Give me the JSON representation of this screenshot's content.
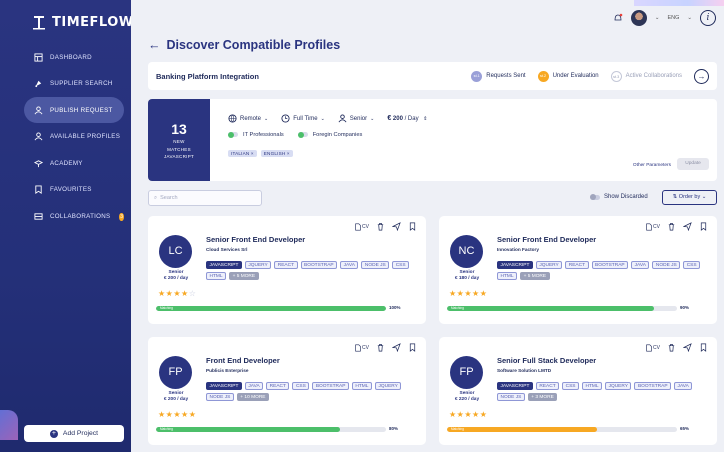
{
  "app": {
    "name": "TIMEFLOW",
    "add_project": "Add Project"
  },
  "sidebar": {
    "items": [
      {
        "label": "DASHBOARD",
        "icon": "dashboard-icon"
      },
      {
        "label": "SUPPLIER SEARCH",
        "icon": "rocket-icon"
      },
      {
        "label": "PUBLISH REQUEST",
        "icon": "people-icon",
        "active": true
      },
      {
        "label": "AVAILABLE PROFILES",
        "icon": "people-icon"
      },
      {
        "label": "ACADEMY",
        "icon": "academy-icon"
      },
      {
        "label": "FAVOURITES",
        "icon": "bookmark-icon"
      },
      {
        "label": "COLLABORATIONS",
        "icon": "collab-icon",
        "badge": "3"
      }
    ]
  },
  "topbar": {
    "lang": "ENG",
    "info": "i"
  },
  "page": {
    "title": "Discover Compatible Profiles"
  },
  "project": {
    "name": "Banking Platform Integration",
    "steps": [
      {
        "label": "Requests Sent",
        "marker": "st.1",
        "color": "#9aa0d8"
      },
      {
        "label": "Under Evaluation",
        "marker": "st.2",
        "color": "#f7a823"
      },
      {
        "label": "Active Collaborations",
        "marker": "st.3",
        "color": "#ffffff"
      }
    ]
  },
  "filter": {
    "count": "13",
    "count_label_1": "NEW",
    "count_label_2": "MATCHES",
    "count_label_3": "JAVASCRIPT",
    "work_mode": "Remote",
    "time": "Full Time",
    "seniority": "Senior",
    "rate_value": "200",
    "rate_unit": "/ Day",
    "toggle_1": "IT Professionals",
    "toggle_2": "Foregin Companies",
    "chips": [
      "ITALIAN ×",
      "ENGLISH ×"
    ],
    "other_params": "Other Parameters",
    "update": "Update"
  },
  "search": {
    "placeholder": "Search"
  },
  "show_discarded": "Show Discarded",
  "order_by": "Order by",
  "cards": [
    {
      "initials": "LC",
      "title": "Senior Front End Developer",
      "company": "Cloud Services Srl",
      "level": "Senior",
      "rate": "€ 200 / day",
      "stars": "★★★★",
      "stars_empty": "☆",
      "skills": [
        "JAVASCRIPT",
        "JQUERY",
        "REACT",
        "BOOTSTRAP",
        "JAVA",
        "NODE JS",
        "CSS",
        "HTML",
        "+ 5 MORE"
      ],
      "match_label": "Matching",
      "match_pct": "100%",
      "match_value": 100,
      "bar_color": "#4cbf6a"
    },
    {
      "initials": "NC",
      "title": "Senior Front End Developer",
      "company": "Innovation Factory",
      "level": "Senior",
      "rate": "€ 180 / day",
      "stars": "★★★★★",
      "stars_empty": "",
      "skills": [
        "JAVASCRIPT",
        "JQUERY",
        "REACT",
        "BOOTSTRAP",
        "JAVA",
        "NODE JS",
        "CSS",
        "HTML",
        "+ 5 MORE"
      ],
      "match_label": "Matching",
      "match_pct": "90%",
      "match_value": 90,
      "bar_color": "#4cbf6a"
    },
    {
      "initials": "FP",
      "title": "Front End Developer",
      "company": "Publicis Enterprise",
      "level": "Senior",
      "rate": "€ 200 / day",
      "stars": "★★★★★",
      "stars_empty": "",
      "skills": [
        "JAVASCRIPT",
        "JAVA",
        "REACT",
        "CSS",
        "BOOTSTRAP",
        "HTML",
        "JQUERY",
        "NODE JS",
        "+ 10 MORE"
      ],
      "match_label": "Matching",
      "match_pct": "80%",
      "match_value": 80,
      "bar_color": "#4cbf6a"
    },
    {
      "initials": "FP",
      "title": "Senior Full Stack Developer",
      "company": "Software Solution LMTD",
      "level": "Senior",
      "rate": "€ 220 / day",
      "stars": "★★★★★",
      "stars_empty": "",
      "skills": [
        "JAVASCRIPT",
        "REACT",
        "CSS",
        "HTML",
        "JQUERY",
        "BOOTSTRAP",
        "JAVA",
        "NODE JS",
        "+ 3 MORE"
      ],
      "match_label": "Matching",
      "match_pct": "65%",
      "match_value": 65,
      "bar_color": "#f7a823"
    }
  ]
}
